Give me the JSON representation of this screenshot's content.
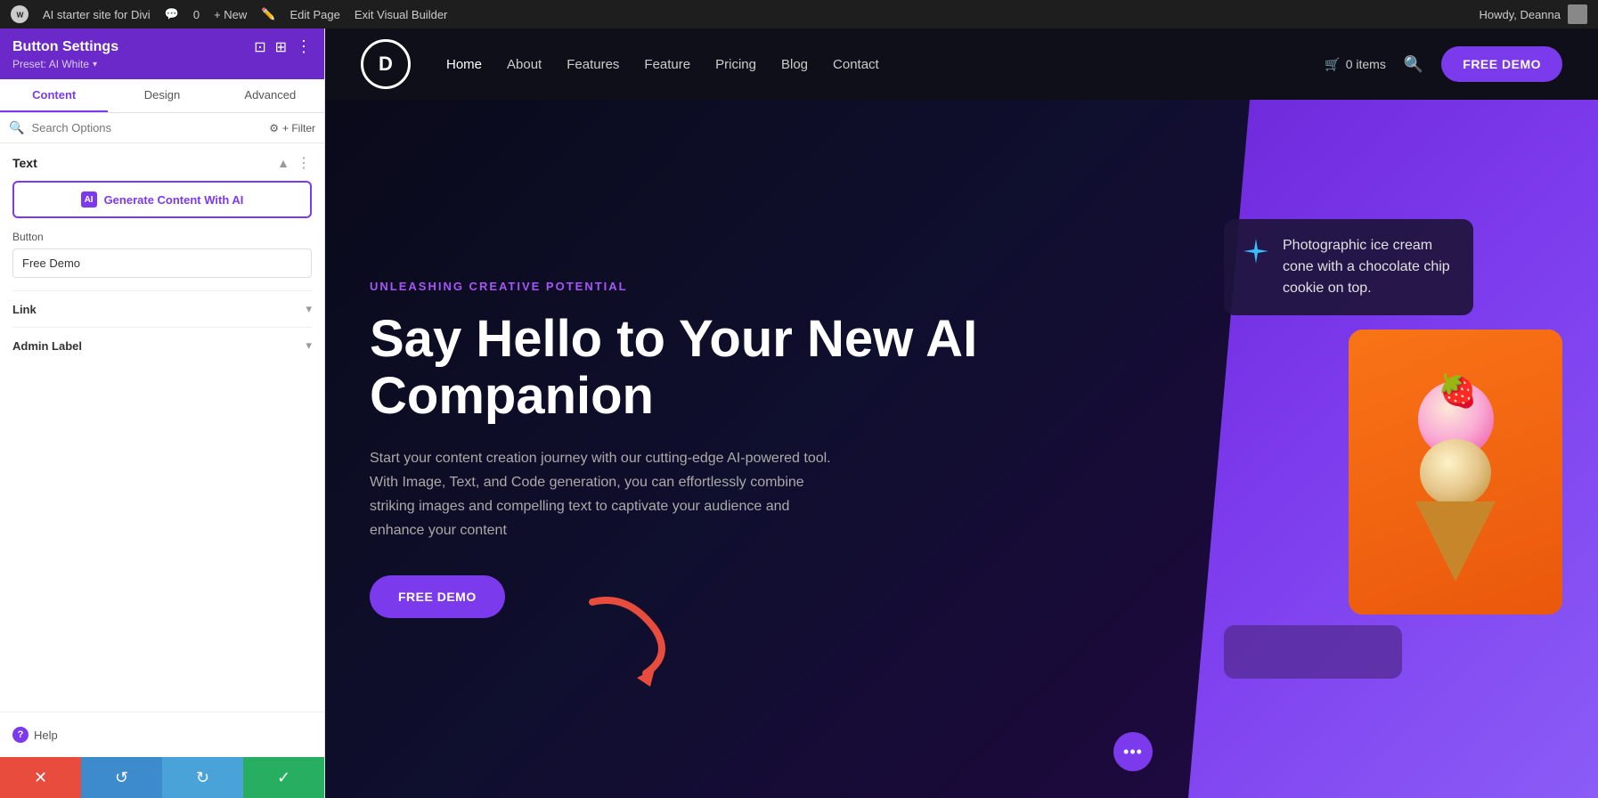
{
  "admin_bar": {
    "wp_logo": "W",
    "site_name": "AI starter site for Divi",
    "comment_icon": "💬",
    "comment_count": "0",
    "new_label": "+ New",
    "edit_page_label": "Edit Page",
    "exit_builder_label": "Exit Visual Builder",
    "howdy_label": "Howdy, Deanna"
  },
  "sidebar": {
    "title": "Button Settings",
    "preset_label": "Preset: AI White",
    "header_icons": [
      "⊡",
      "⊞",
      "⋮"
    ],
    "tabs": [
      {
        "id": "content",
        "label": "Content",
        "active": true
      },
      {
        "id": "design",
        "label": "Design",
        "active": false
      },
      {
        "id": "advanced",
        "label": "Advanced",
        "active": false
      }
    ],
    "search_placeholder": "Search Options",
    "filter_label": "+ Filter",
    "sections": {
      "text": {
        "title": "Text",
        "generate_btn": "Generate Content With AI",
        "ai_icon": "AI"
      },
      "button": {
        "label": "Button",
        "value": "Free Demo"
      },
      "link": {
        "title": "Link"
      },
      "admin_label": {
        "title": "Admin Label"
      }
    },
    "help_label": "Help"
  },
  "bottom_bar": {
    "cancel_icon": "✕",
    "undo_icon": "↺",
    "redo_icon": "↻",
    "confirm_icon": "✓"
  },
  "site_nav": {
    "logo": "D",
    "links": [
      {
        "label": "Home",
        "active": true
      },
      {
        "label": "About",
        "active": false
      },
      {
        "label": "Features",
        "active": false
      },
      {
        "label": "Feature",
        "active": false
      },
      {
        "label": "Pricing",
        "active": false
      },
      {
        "label": "Blog",
        "active": false
      },
      {
        "label": "Contact",
        "active": false
      }
    ],
    "cart_label": "0 items",
    "free_demo_label": "FREE DEMO"
  },
  "hero": {
    "tagline": "UNLEASHING CREATIVE POTENTIAL",
    "title": "Say Hello to Your New AI Companion",
    "description": "Start your content creation journey with our cutting-edge AI-powered tool. With Image, Text, and Code generation, you can effortlessly combine striking images and compelling text to captivate your audience and enhance your content",
    "cta_label": "FREE DEMO",
    "ai_tooltip_text": "Photographic ice cream cone with a chocolate chip cookie on top.",
    "dots_icon": "•••"
  },
  "colors": {
    "purple_primary": "#7c3aed",
    "purple_light": "#a855f7",
    "bg_dark": "#0a0a1a",
    "nav_bg": "#0f0f1a",
    "sidebar_header": "#6a29c8",
    "cancel_red": "#e74c3c",
    "undo_blue": "#3d8bcd",
    "redo_teal": "#4aa3d8",
    "confirm_green": "#27ae60"
  }
}
